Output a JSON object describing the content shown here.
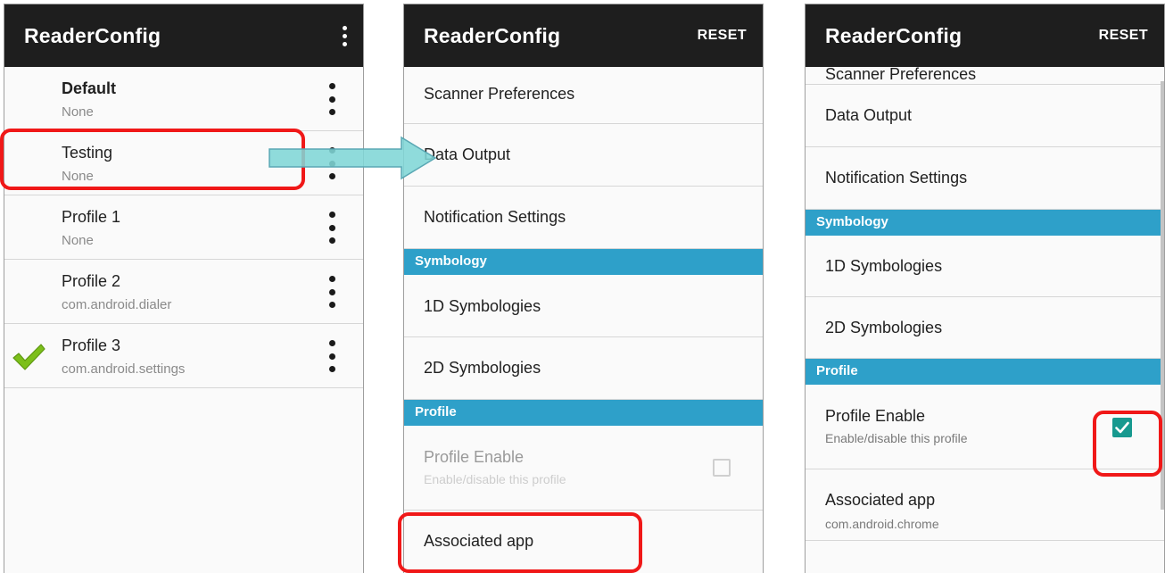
{
  "app_title": "ReaderConfig",
  "reset_label": "RESET",
  "profiles": [
    {
      "name": "Default",
      "app": "None"
    },
    {
      "name": "Testing",
      "app": "None"
    },
    {
      "name": "Profile 1",
      "app": "None"
    },
    {
      "name": "Profile 2",
      "app": "com.android.dialer"
    },
    {
      "name": "Profile 3",
      "app": "com.android.settings"
    }
  ],
  "settings": {
    "scanner_preferences": "Scanner Preferences",
    "data_output": "Data Output",
    "notification_settings": "Notification Settings",
    "section_symbology": "Symbology",
    "symbologies_1d": "1D Symbologies",
    "symbologies_2d": "2D Symbologies",
    "section_profile": "Profile",
    "profile_enable": "Profile Enable",
    "profile_enable_sub": "Enable/disable this profile",
    "associated_app": "Associated app",
    "associated_app_value": "com.android.chrome"
  },
  "state": {
    "active_profile": "Profile 3",
    "profile_enable_screen2": false,
    "profile_enable_screen3": true
  },
  "colors": {
    "app_bar": "#1e1e1e",
    "section_header": "#2ea0c9",
    "checkbox_checked": "#17998f",
    "highlight": "#f01818",
    "arrow": "#7fd6d6",
    "check_mark": "#7cbf1a"
  },
  "icons": {
    "overflow": "more-vert-icon",
    "active_profile": "checkmark-icon",
    "checked": "checkbox-checked-icon",
    "unchecked": "checkbox-empty-icon",
    "callout": "arrow-right-icon"
  }
}
